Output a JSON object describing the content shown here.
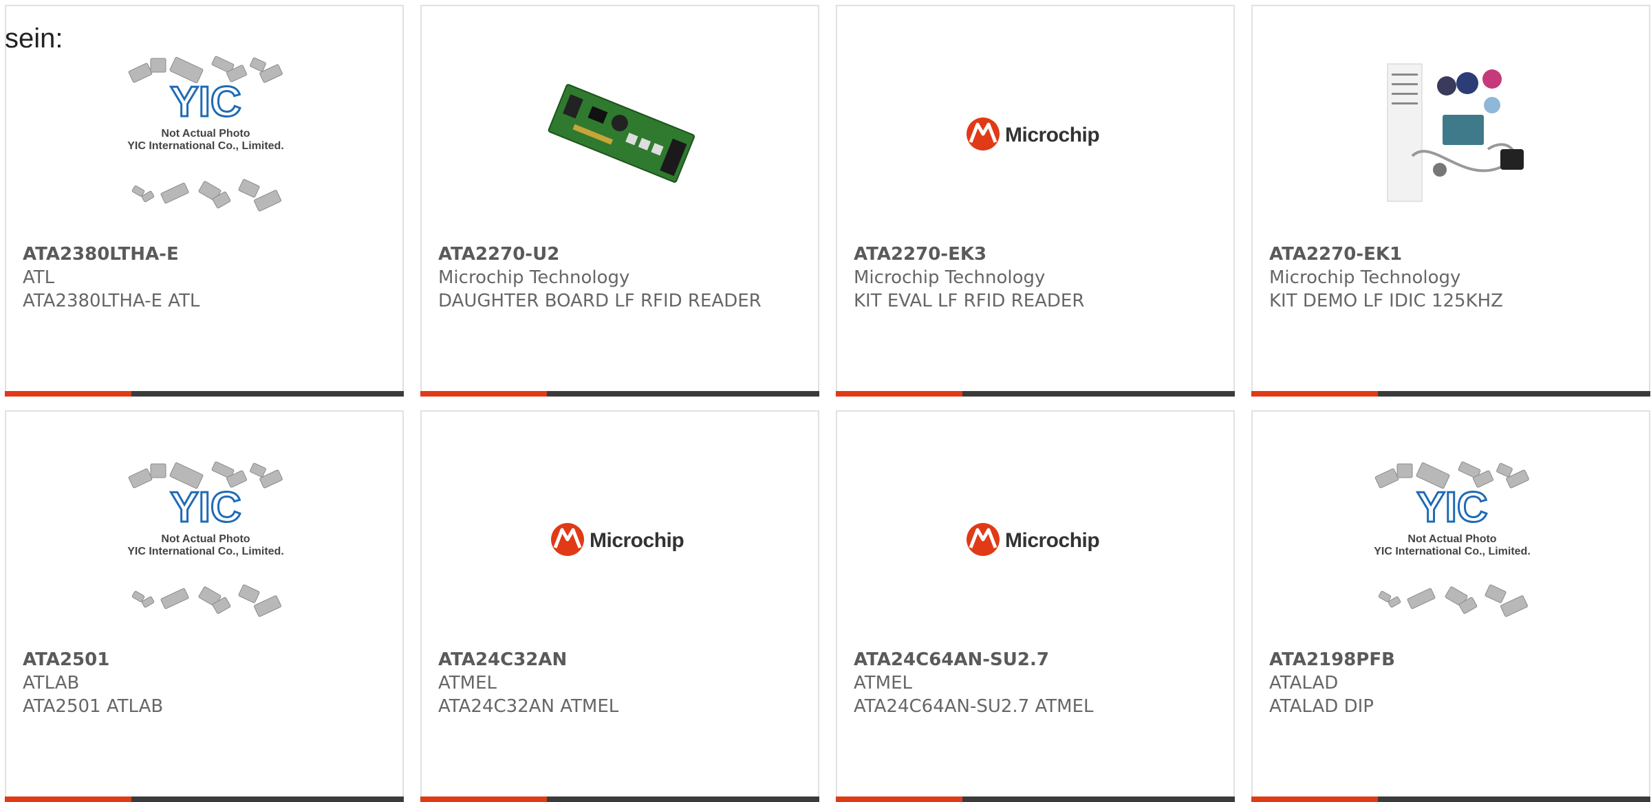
{
  "page": {
    "top_label": "sein:"
  },
  "colors": {
    "accent": "#e03a16",
    "bar": "#3b3b3b",
    "text": "#666666",
    "border": "#e1e1e1"
  },
  "placeholder": {
    "line1": "Not Actual Photo",
    "line2": "YIC International Co., Limited."
  },
  "microchip_logo_text": "Microchip",
  "products": [
    {
      "part": "ATA2380LTHA-E",
      "maker": "ATL",
      "desc": "ATA2380LTHA-E ATL",
      "image": "yic-placeholder-icon"
    },
    {
      "part": "ATA2270-U2",
      "maker": "Microchip Technology",
      "desc": "DAUGHTER BOARD LF RFID READER",
      "image": "pcb-board-photo"
    },
    {
      "part": "ATA2270-EK3",
      "maker": "Microchip Technology",
      "desc": "KIT EVAL LF RFID READER",
      "image": "microchip-logo"
    },
    {
      "part": "ATA2270-EK1",
      "maker": "Microchip Technology",
      "desc": "KIT DEMO LF IDIC 125KHZ",
      "image": "kit-contents-photo"
    },
    {
      "part": "ATA2501",
      "maker": "ATLAB",
      "desc": "ATA2501 ATLAB",
      "image": "yic-placeholder-icon"
    },
    {
      "part": "ATA24C32AN",
      "maker": "ATMEL",
      "desc": "ATA24C32AN ATMEL",
      "image": "microchip-logo"
    },
    {
      "part": "ATA24C64AN-SU2.7",
      "maker": "ATMEL",
      "desc": "ATA24C64AN-SU2.7 ATMEL",
      "image": "microchip-logo"
    },
    {
      "part": "ATA2198PFB",
      "maker": "ATALAD",
      "desc": "ATALAD DIP",
      "image": "yic-placeholder-icon"
    }
  ]
}
